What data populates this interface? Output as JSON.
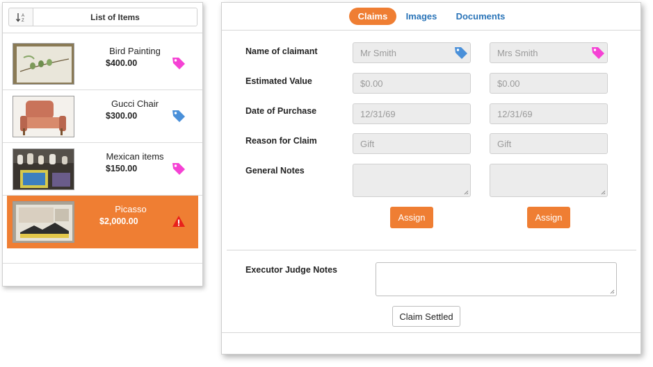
{
  "left": {
    "title": "List of Items",
    "sort_icon": "sort-alpha-icon",
    "items": [
      {
        "name": "Bird Painting",
        "price": "$400.00",
        "tag_color": "#f542d4",
        "icon": "tag-icon"
      },
      {
        "name": "Gucci Chair",
        "price": "$300.00",
        "tag_color": "#4a90d9",
        "icon": "tag-icon"
      },
      {
        "name": "Mexican items",
        "price": "$150.00",
        "tag_color": "#f542d4",
        "icon": "tag-icon"
      },
      {
        "name": "Picasso",
        "price": "$2,000.00",
        "selected": true,
        "icon": "warning-icon",
        "warning_color": "#e8211b"
      }
    ]
  },
  "tabs": [
    {
      "label": "Claims",
      "active": true
    },
    {
      "label": "Images"
    },
    {
      "label": "Documents"
    }
  ],
  "claims": {
    "labels": {
      "name": "Name of claimant",
      "value": "Estimated Value",
      "date": "Date of Purchase",
      "reason": "Reason for Claim",
      "notes": "General Notes"
    },
    "claimants": [
      {
        "name": "Mr Smith",
        "value": "$0.00",
        "date": "12/31/69",
        "reason": "Gift",
        "notes": "",
        "tag_color": "#4a90d9"
      },
      {
        "name": "Mrs Smith",
        "value": "$0.00",
        "date": "12/31/69",
        "reason": "Gift",
        "notes": "",
        "tag_color": "#f542d4"
      }
    ],
    "assign_label": "Assign"
  },
  "executor": {
    "label": "Executor Judge Notes",
    "notes": "",
    "settled_label": "Claim Settled"
  },
  "colors": {
    "accent": "#ef7e33",
    "link": "#2a74b8"
  }
}
